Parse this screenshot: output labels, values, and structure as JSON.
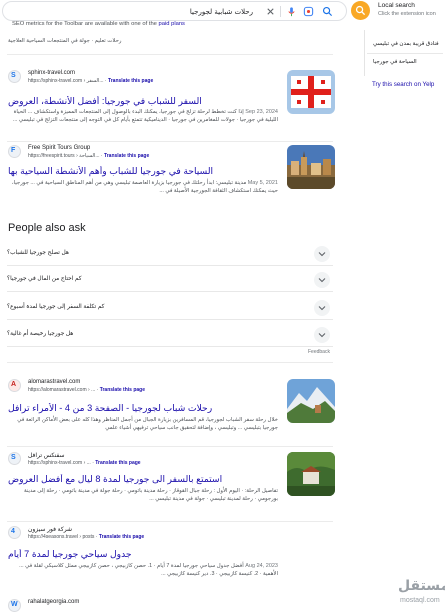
{
  "search": {
    "query": "رحلات شبابية لجورجيا"
  },
  "local_panel": {
    "title": "Local search",
    "subtitle": "Click the extension icon",
    "items": [
      "فنادق قريبة بمدن في تبليسي",
      "السياحة في جورجيا"
    ],
    "try_yelp": "Try this search on Yelp"
  },
  "seo": {
    "text": "SEO metrics for the Toolbar are available with one of the",
    "link": "paid plans"
  },
  "top_snippet": "رحلات تعليم · جولة في المنتجعات السياحية العلاجية",
  "results": [
    {
      "site": "sphinx-travel.com",
      "url": "https://sphinx-travel.com › السفر...",
      "translate": "Translate this page",
      "title": "السفر للشباب في جورجيا: أفضل الأنشطة، العروض",
      "date": "Sep 23, 2024",
      "snippet": "إذا كنت تخطط لرحلة تزلج في جورجيا، يمكنك البدء بالوصول إلى المنتجعات المميزة واستكشاف ... الحياة الليلية في جورجيا · جولات للمغامرين في جورجيا · الديناميكية تتمتع بأيام كل في التوجه إلى منتجعات التزلج في تبليسي ..."
    },
    {
      "site": "Free Spirit Tours Group",
      "url": "https://freespirit.tours › السياحة...",
      "translate": "Translate this page",
      "title": "السياحة في جورجيا للشباب وأهم الأنشطة السياحية بها",
      "date": "May 5, 2021",
      "snippet": "مدينة تبليسي: ابدأ رحلتك في جورجيا بزيارة العاصمة تبليسي وهي من أهم المناطق السياحية في ... جورجيا، حيث يمكنك استكشاف الثقافة الجورجية الأصيلة في ..."
    },
    {
      "site": "alomarastravel.com",
      "url": "https://alomarastravel.com › ...",
      "translate": "Translate this page",
      "title": "رحلات شباب لجورجيا - الصفحة 3 من 4 - الأمراء ترافل",
      "date": "",
      "snippet": "خلال رحلة سفر الشباب لجورجيا، قم المسافرين بزيارة الجبال من أجمل المناظر وهذا كله على بعض الأماكن الرائعة في جورجيا بتبليسي ... وتبليسي ، وإضافة لتحقيق جانب سياحي ترفيهي أشياء علمي"
    },
    {
      "site": "سفنكس ترافل",
      "url": "https://sphinx-travel.com › ...",
      "translate": "Translate this page",
      "title": "استمتع بالسفر الى جورجيا لمدة 8 ليال مع أفضل العروض",
      "date": "",
      "snippet": "تفاصيل الرحلة: · اليوم الأول : رحلة جبال القوقاز · رحلة مدينة باتومي · رحلة جولة في مدينة باتومي · رحلة إلى مدينة بورجومي · رحلة لمدينة تبليسي · جولة في مدينة تبليسي ..."
    },
    {
      "site": "شركة فور سيزون",
      "url": "https://4seasons.travel › posts",
      "translate": "Translate this page",
      "title": "جدول سياحي جورجيا لمدة 7 أيام",
      "date": "Aug 24, 2023",
      "snippet": "أفضل جدول سياحي جورجيا لمدة 7 أيام · 1. حصن كازبيجي ، حصن كازبيجي ممثل كلاسيكي لقلة في ... الأهمية · 2. كنيسة كازبيجي · 3. دير كنيسة كازبيجي ..."
    },
    {
      "site": "rahalatgeorgia.com",
      "url": "",
      "translate": "",
      "title": "",
      "date": "",
      "snippet": ""
    }
  ],
  "paa": {
    "title": "People also ask",
    "questions": [
      "هل تصلح جورجيا للشباب؟",
      "كم احتاج من المال في جورجيا؟",
      "كم تكلفة السفر إلى جورجيا لمدة أسبوع؟",
      "هل جورجيا رخيصة أم غالية؟"
    ],
    "feedback": "Feedback"
  },
  "watermark": {
    "arabic": "مستقل",
    "latin": "mostaql.com"
  },
  "colors": {
    "link": "#1a0dab",
    "accent": "#f9a825",
    "muted": "#70757a"
  }
}
